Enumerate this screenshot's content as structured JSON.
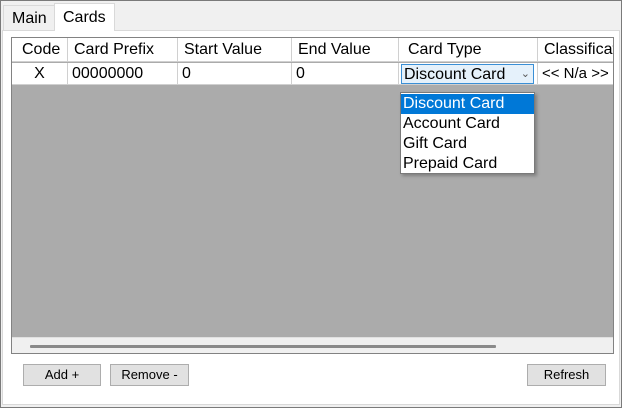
{
  "tabs": [
    {
      "label": "Main",
      "active": false
    },
    {
      "label": "Cards",
      "active": true
    }
  ],
  "grid": {
    "columns": [
      "Code",
      "Card Prefix",
      "Start Value",
      "End Value",
      "Card Type",
      "Classificat"
    ],
    "rows": [
      {
        "code": "X",
        "card_prefix": "00000000",
        "start_value": "0",
        "end_value": "0",
        "card_type": "Discount Card",
        "classification": "<< N/a >>"
      }
    ]
  },
  "card_type_dropdown": {
    "options": [
      "Discount Card",
      "Account Card",
      "Gift Card",
      "Prepaid Card"
    ],
    "selected": "Discount Card",
    "chevron_glyph": "⌄"
  },
  "buttons": {
    "add": "Add +",
    "remove": "Remove -",
    "refresh": "Refresh"
  },
  "colors": {
    "selection": "#0078d7",
    "grid_background": "#ababab"
  }
}
